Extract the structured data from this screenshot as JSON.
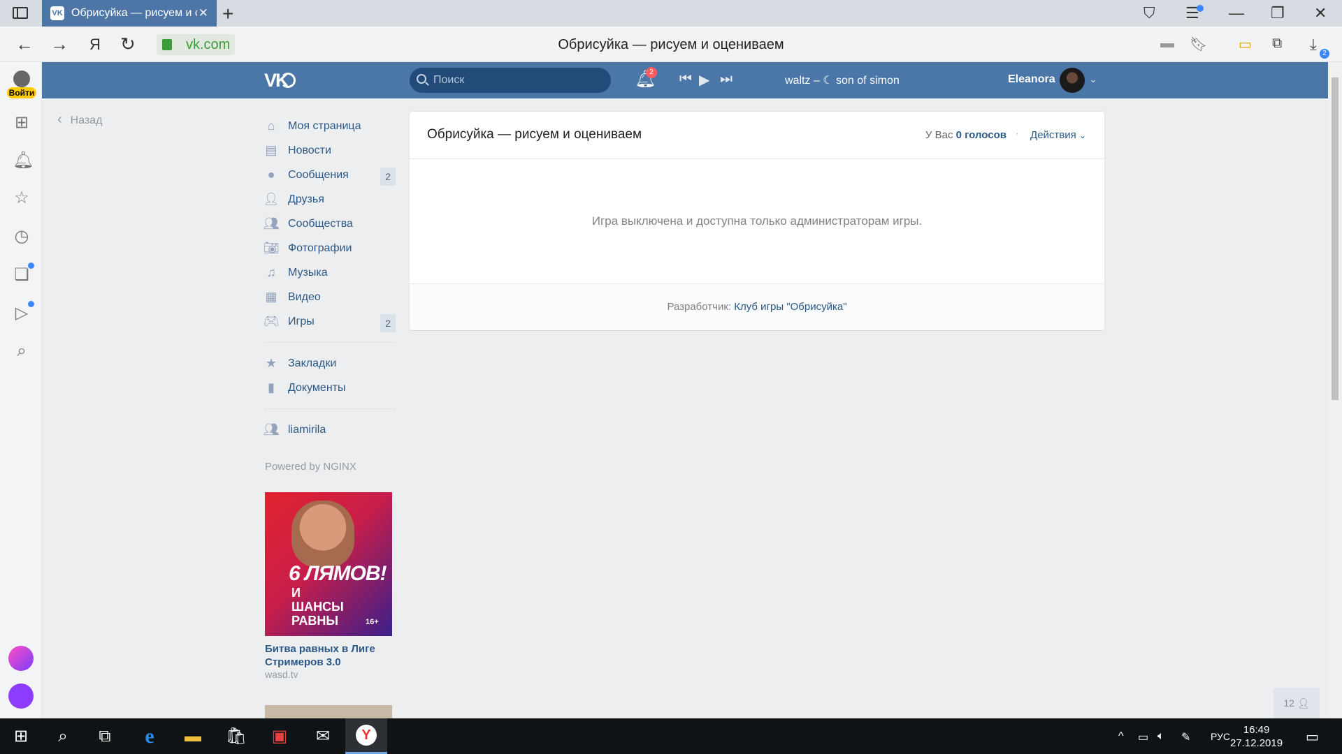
{
  "browser": {
    "tab_title": "Обрисуйка — рисуем и оценивае",
    "tab_favicon": "VK",
    "url": "vk.com",
    "page_title": "Обрисуйка — рисуем и оцениваем",
    "downloads_count": "2"
  },
  "yandex_sidebar": {
    "login_label": "Войти",
    "icons": [
      "apps-icon",
      "bell-icon",
      "star-icon",
      "history-icon",
      "collections-icon",
      "video-icon",
      "search-page-icon"
    ],
    "bottom_apps": [
      "alice-app-icon",
      "yandex-alice-icon"
    ]
  },
  "vk_header": {
    "logo": "VK",
    "search_placeholder": "Поиск",
    "notifications_count": "2",
    "track": "waltz – ☾ son of simon",
    "user_name": "Eleanora"
  },
  "left_nav": {
    "back_label": "Назад",
    "items": [
      {
        "label": "Моя страница",
        "icon": "home-icon",
        "count": ""
      },
      {
        "label": "Новости",
        "icon": "news-icon",
        "count": ""
      },
      {
        "label": "Сообщения",
        "icon": "messages-icon",
        "count": "2"
      },
      {
        "label": "Друзья",
        "icon": "friends-icon",
        "count": ""
      },
      {
        "label": "Сообщества",
        "icon": "groups-icon",
        "count": ""
      },
      {
        "label": "Фотографии",
        "icon": "photo-icon",
        "count": ""
      },
      {
        "label": "Музыка",
        "icon": "music-icon",
        "count": ""
      },
      {
        "label": "Видео",
        "icon": "video-icon",
        "count": ""
      },
      {
        "label": "Игры",
        "icon": "games-icon",
        "count": "2"
      }
    ],
    "secondary": [
      {
        "label": "Закладки",
        "icon": "bookmark-star-icon"
      },
      {
        "label": "Документы",
        "icon": "document-icon"
      }
    ],
    "group": {
      "label": "liamirila",
      "icon": "group-icon"
    },
    "powered": "Powered by NGINX"
  },
  "ad": {
    "image_text": "6 ЛЯМОВ!",
    "image_subtext": "И ШАНСЫ РАВНЫ",
    "age": "16+",
    "title": "Битва равных в Лиге Стримеров 3.0",
    "site": "wasd.tv"
  },
  "app_card": {
    "title": "Обрисуйка — рисуем и оцениваем",
    "votes_prefix": "У Вас",
    "votes_value": "0 голосов",
    "actions_label": "Действия",
    "message": "Игра выключена и доступна только администраторам игры.",
    "developer_prefix": "Разработчик:",
    "developer_link": "Клуб игры \"Обрисуйка\""
  },
  "online_count": "12",
  "taskbar": {
    "language": "РУС",
    "time": "16:49",
    "date": "27.12.2019"
  },
  "colors": {
    "vk_header": "#4a76a8",
    "link": "#2a5885",
    "tab_active": "#4d76a6"
  }
}
